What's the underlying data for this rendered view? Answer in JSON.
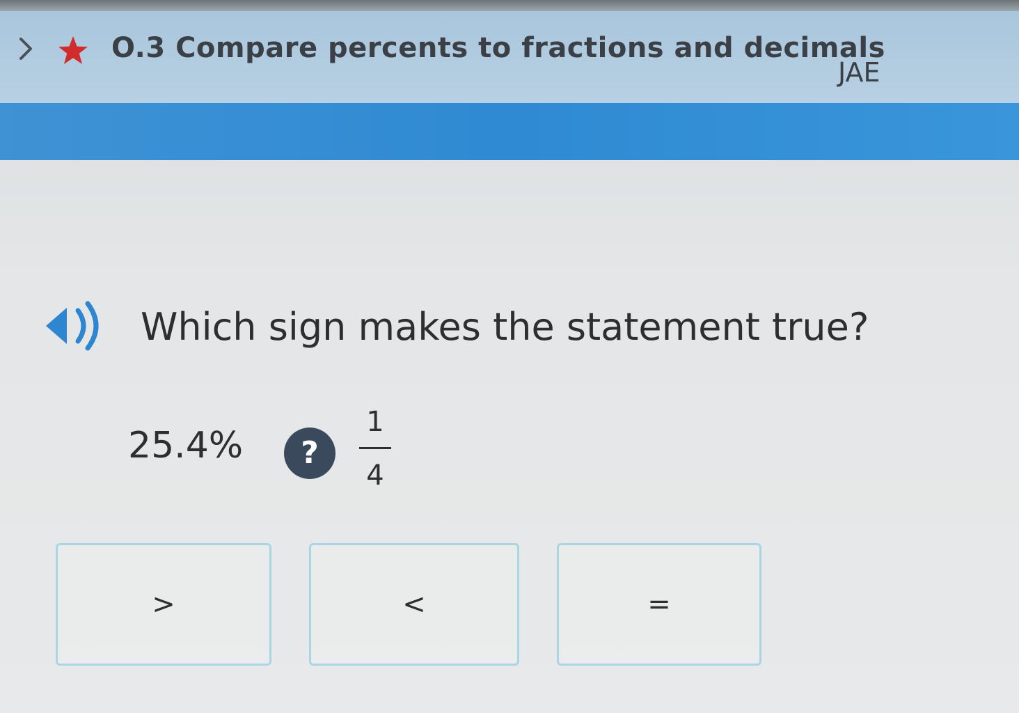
{
  "header": {
    "title": "O.3 Compare percents to fractions and decimals",
    "code": "JAE"
  },
  "icons": {
    "breadcrumb": "chevron-right-icon",
    "favorite": "star-icon",
    "audio": "speaker-icon"
  },
  "colors": {
    "accent_bar": "#2f8ad3",
    "star": "#d22b2b",
    "choice_border": "#aad6e4",
    "badge": "#3a4a5c"
  },
  "question": {
    "prompt": "Which sign makes the statement true?",
    "left_value": "25.4%",
    "unknown_badge": "?",
    "fraction": {
      "numerator": "1",
      "denominator": "4"
    }
  },
  "choices": [
    {
      "label": ">"
    },
    {
      "label": "<"
    },
    {
      "label": "="
    }
  ]
}
